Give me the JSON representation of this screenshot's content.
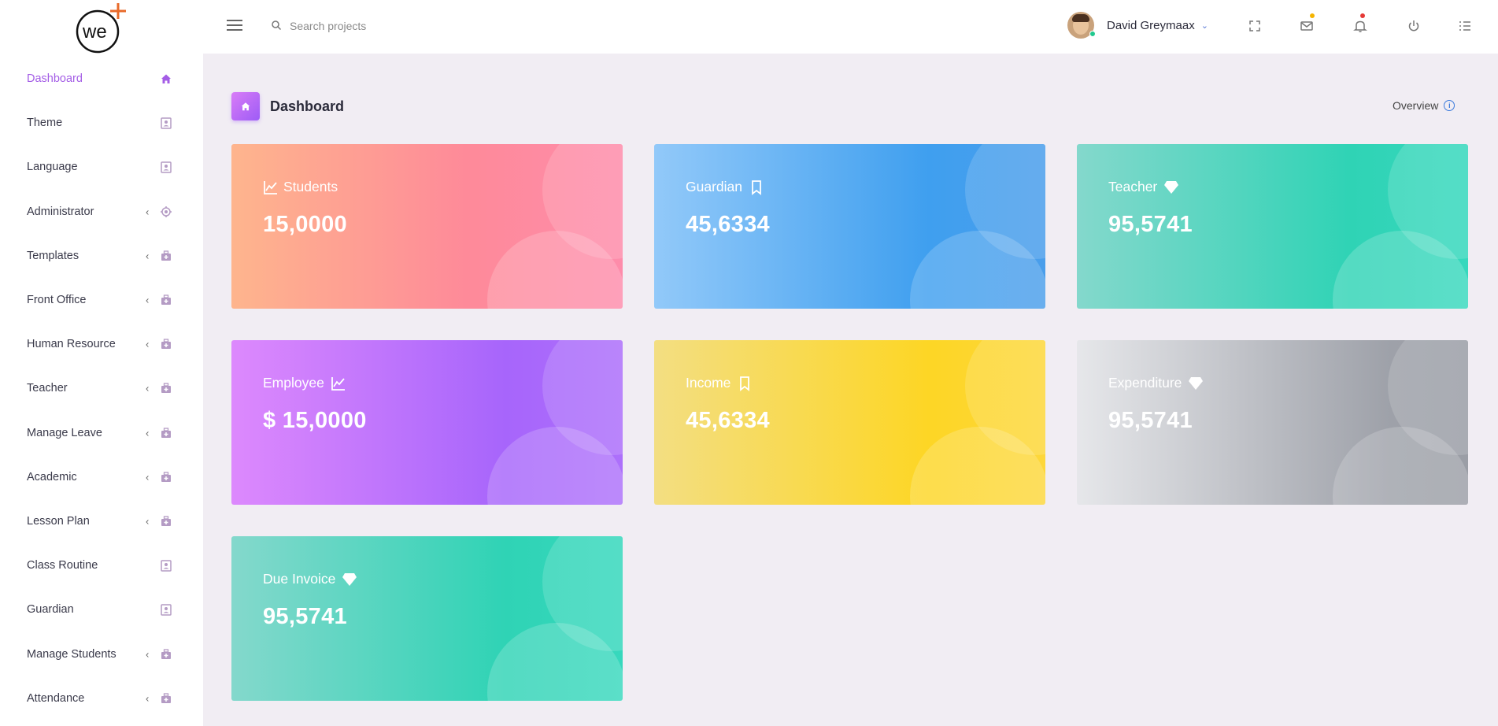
{
  "brand": {
    "logo_text": "we"
  },
  "sidebar": {
    "items": [
      {
        "label": "Dashboard",
        "active": true,
        "has_children": false,
        "icon": "home-icon"
      },
      {
        "label": "Theme",
        "has_children": false,
        "icon": "contact-card-icon"
      },
      {
        "label": "Language",
        "has_children": false,
        "icon": "contact-card-icon"
      },
      {
        "label": "Administrator",
        "has_children": true,
        "icon": "target-icon"
      },
      {
        "label": "Templates",
        "has_children": true,
        "icon": "medkit-icon"
      },
      {
        "label": "Front Office",
        "has_children": true,
        "icon": "medkit-icon"
      },
      {
        "label": "Human Resource",
        "has_children": true,
        "icon": "medkit-icon"
      },
      {
        "label": "Teacher",
        "has_children": true,
        "icon": "medkit-icon"
      },
      {
        "label": "Manage Leave",
        "has_children": true,
        "icon": "medkit-icon"
      },
      {
        "label": "Academic",
        "has_children": true,
        "icon": "medkit-icon"
      },
      {
        "label": "Lesson Plan",
        "has_children": true,
        "icon": "medkit-icon"
      },
      {
        "label": "Class Routine",
        "has_children": false,
        "icon": "contact-card-icon"
      },
      {
        "label": "Guardian",
        "has_children": false,
        "icon": "contact-card-icon"
      },
      {
        "label": "Manage Students",
        "has_children": true,
        "icon": "medkit-icon"
      },
      {
        "label": "Attendance",
        "has_children": true,
        "icon": "medkit-icon"
      }
    ]
  },
  "header": {
    "search_placeholder": "Search projects",
    "user_name": "David Greymaax",
    "icons": [
      "menu-icon",
      "search-icon",
      "fullscreen-icon",
      "mail-icon",
      "bell-icon",
      "power-icon",
      "list-icon"
    ]
  },
  "page": {
    "title": "Dashboard",
    "overview_label": "Overview"
  },
  "cards": [
    {
      "label": "Students",
      "value": "15,0000",
      "icon": "chart-line-icon",
      "icon_position": "before"
    },
    {
      "label": "Guardian",
      "value": "45,6334",
      "icon": "bookmark-icon",
      "icon_position": "after"
    },
    {
      "label": "Teacher",
      "value": "95,5741",
      "icon": "diamond-icon",
      "icon_position": "after"
    },
    {
      "label": "Employee",
      "value": "$ 15,0000",
      "icon": "chart-line-icon",
      "icon_position": "after"
    },
    {
      "label": "Income",
      "value": "45,6334",
      "icon": "bookmark-icon",
      "icon_position": "after"
    },
    {
      "label": "Expenditure",
      "value": "95,5741",
      "icon": "diamond-icon",
      "icon_position": "after"
    },
    {
      "label": "Due Invoice",
      "value": "95,5741",
      "icon": "diamond-icon",
      "icon_position": "after"
    }
  ],
  "colors": {
    "accent": "#a45de6",
    "mail_badge": "#f5b400",
    "bell_badge": "#e53935",
    "online_status": "#21c98f"
  }
}
